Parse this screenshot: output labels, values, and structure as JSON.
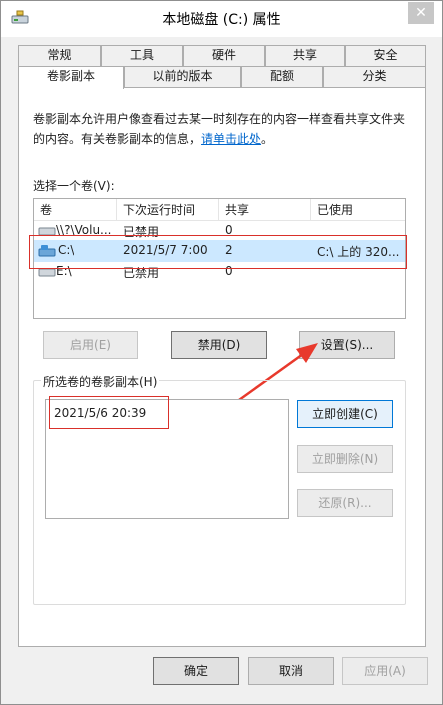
{
  "window": {
    "title": "本地磁盘 (C:) 属性",
    "close_glyph": "✕"
  },
  "tabs_row1": [
    {
      "label": "常规"
    },
    {
      "label": "工具"
    },
    {
      "label": "硬件"
    },
    {
      "label": "共享"
    },
    {
      "label": "安全"
    }
  ],
  "tabs_row2": [
    {
      "label": "卷影副本"
    },
    {
      "label": "以前的版本"
    },
    {
      "label": "配额"
    },
    {
      "label": "分类"
    }
  ],
  "shadow_copies": {
    "description": "卷影副本允许用户像查看过去某一时刻存在的内容一样查看共享文件夹的内容。有关卷影副本的信息，",
    "link_text": "请单击此处",
    "description_end": "。",
    "select_volume_label": "选择一个卷(V):",
    "columns": {
      "volume": "卷",
      "next_run": "下次运行时间",
      "shares": "共享",
      "used": "已使用"
    },
    "rows": [
      {
        "volume": "\\\\?\\Volu...",
        "next_run": "已禁用",
        "shares": "0",
        "used": ""
      },
      {
        "volume": "C:\\",
        "next_run": "2021/5/7 7:00",
        "shares": "2",
        "used": "C:\\ 上的 320..."
      },
      {
        "volume": "E:\\",
        "next_run": "已禁用",
        "shares": "0",
        "used": ""
      }
    ],
    "enable_button": "启用(E)",
    "disable_button": "禁用(D)",
    "settings_button": "设置(S)...",
    "group_title": "所选卷的卷影副本(H)",
    "snapshots": [
      "2021/5/6 20:39"
    ],
    "create_now_button": "立即创建(C)",
    "delete_now_button": "立即删除(N)",
    "revert_button": "还原(R)..."
  },
  "footer": {
    "ok": "确定",
    "cancel": "取消",
    "apply": "应用(A)"
  },
  "colors": {
    "highlight": "#cce8ff",
    "annotation_red": "#d9302a",
    "link": "#0066cc"
  }
}
